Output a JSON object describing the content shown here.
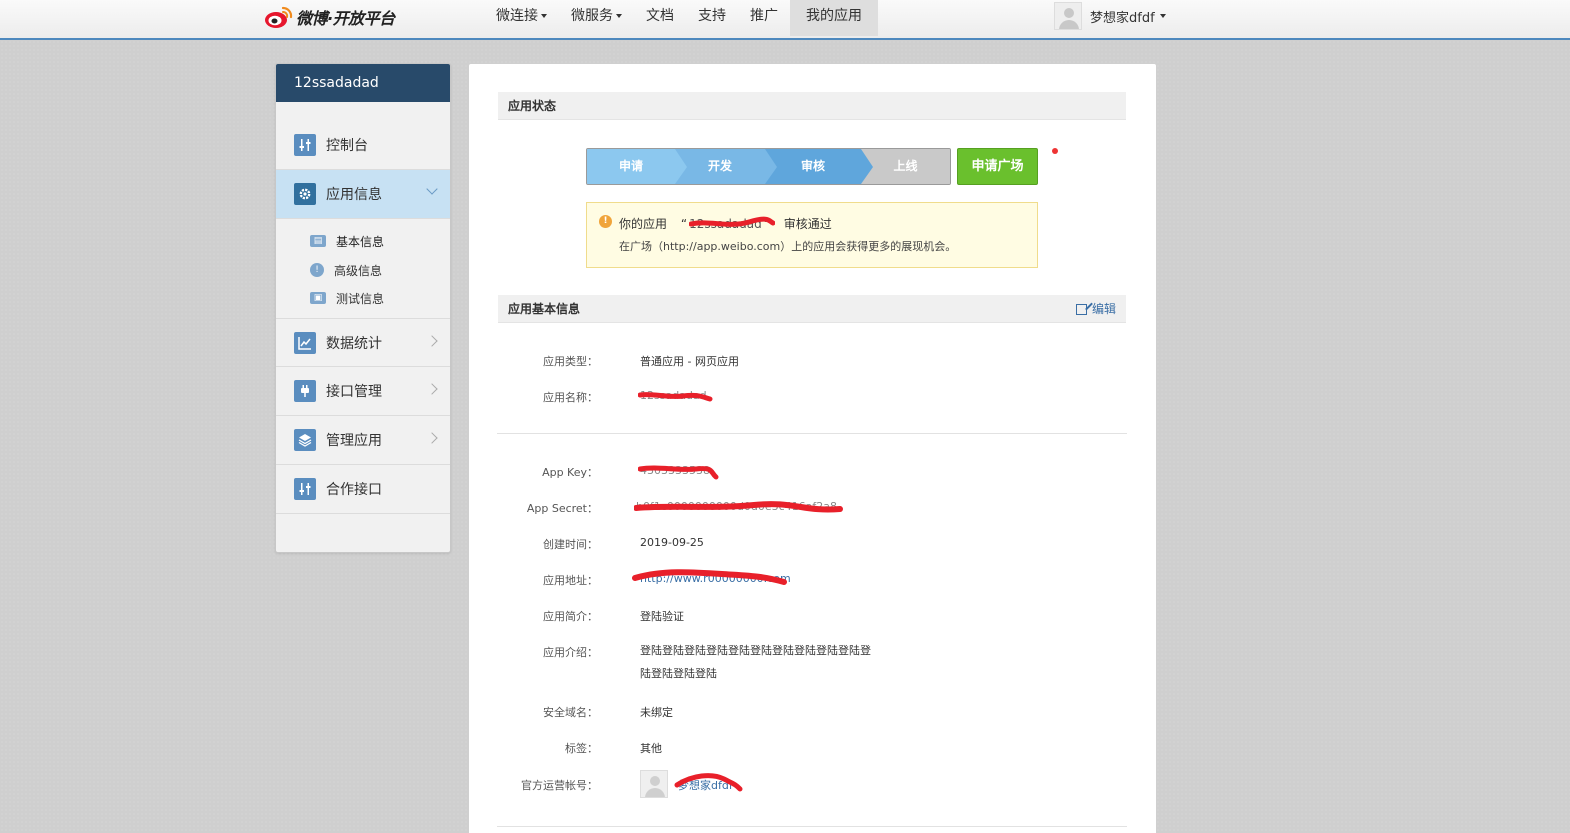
{
  "brand": {
    "logo_text": "微博·开放平台"
  },
  "nav": {
    "items": [
      {
        "label": "微连接",
        "has_caret": true
      },
      {
        "label": "微服务",
        "has_caret": true
      },
      {
        "label": "文档",
        "has_caret": false
      },
      {
        "label": "支持",
        "has_caret": false
      },
      {
        "label": "推广",
        "has_caret": false
      },
      {
        "label": "我的应用",
        "has_caret": false,
        "active": true
      }
    ]
  },
  "user": {
    "name": "梦想家dfdf"
  },
  "sidebar": {
    "app_name": "12ssadadad",
    "items": [
      {
        "label": "控制台",
        "icon": "sliders-icon"
      },
      {
        "label": "应用信息",
        "icon": "gear-icon",
        "active": true,
        "expanded": true
      },
      {
        "label": "数据统计",
        "icon": "chart-icon"
      },
      {
        "label": "接口管理",
        "icon": "plug-icon"
      },
      {
        "label": "管理应用",
        "icon": "layers-icon"
      },
      {
        "label": "合作接口",
        "icon": "sliders-icon"
      }
    ],
    "sub_items": [
      {
        "label": "基本信息",
        "icon": "id-card-icon",
        "current": true
      },
      {
        "label": "高级信息",
        "icon": "info-icon"
      },
      {
        "label": "测试信息",
        "icon": "contact-card-icon"
      }
    ]
  },
  "status_section": {
    "title": "应用状态",
    "steps": [
      "申请",
      "开发",
      "审核",
      "上线"
    ],
    "current_step": 3,
    "plaza_button": "申请广场",
    "notice": {
      "prefix": "你的应用",
      "app_name_redacted": "12ssadadad",
      "suffix": "审核通过",
      "line2": "在广场（http://app.weibo.com）上的应用会获得更多的展现机会。"
    }
  },
  "basic_section": {
    "title": "应用基本信息",
    "edit_label": "编辑",
    "fields": {
      "app_type_label": "应用类型：",
      "app_type_value": "普通应用 - 网页应用",
      "app_name_label": "应用名称：",
      "app_name_value": "12ssadadad"
    }
  },
  "detail_section": {
    "app_key_label": "App Key：",
    "app_key_value": "4303333538",
    "app_secret_label": "App Secret：",
    "app_secret_value": "b0f1c0000000000d0d0e3c416af2a8",
    "created_label": "创建时间：",
    "created_value": "2019-09-25",
    "address_label": "应用地址：",
    "address_value": "http://www.r00000000.com",
    "summary_label": "应用简介：",
    "summary_value": "登陆验证",
    "intro_label": "应用介绍：",
    "intro_value": "登陆登陆登陆登陆登陆登陆登陆登陆登陆登陆登陆登陆登陆登陆",
    "domain_label": "安全域名：",
    "domain_value": "未绑定",
    "tags_label": "标签：",
    "tags_value": "其他",
    "official_label": "官方运营帐号：",
    "official_value": "梦想家dfdf"
  },
  "colors": {
    "header_border": "#4d88bd",
    "sidebar_head": "#284a6a",
    "sidebar_active": "#c7e1f3",
    "plaza_green": "#6ac02d",
    "redaction_red": "#e8202a"
  }
}
